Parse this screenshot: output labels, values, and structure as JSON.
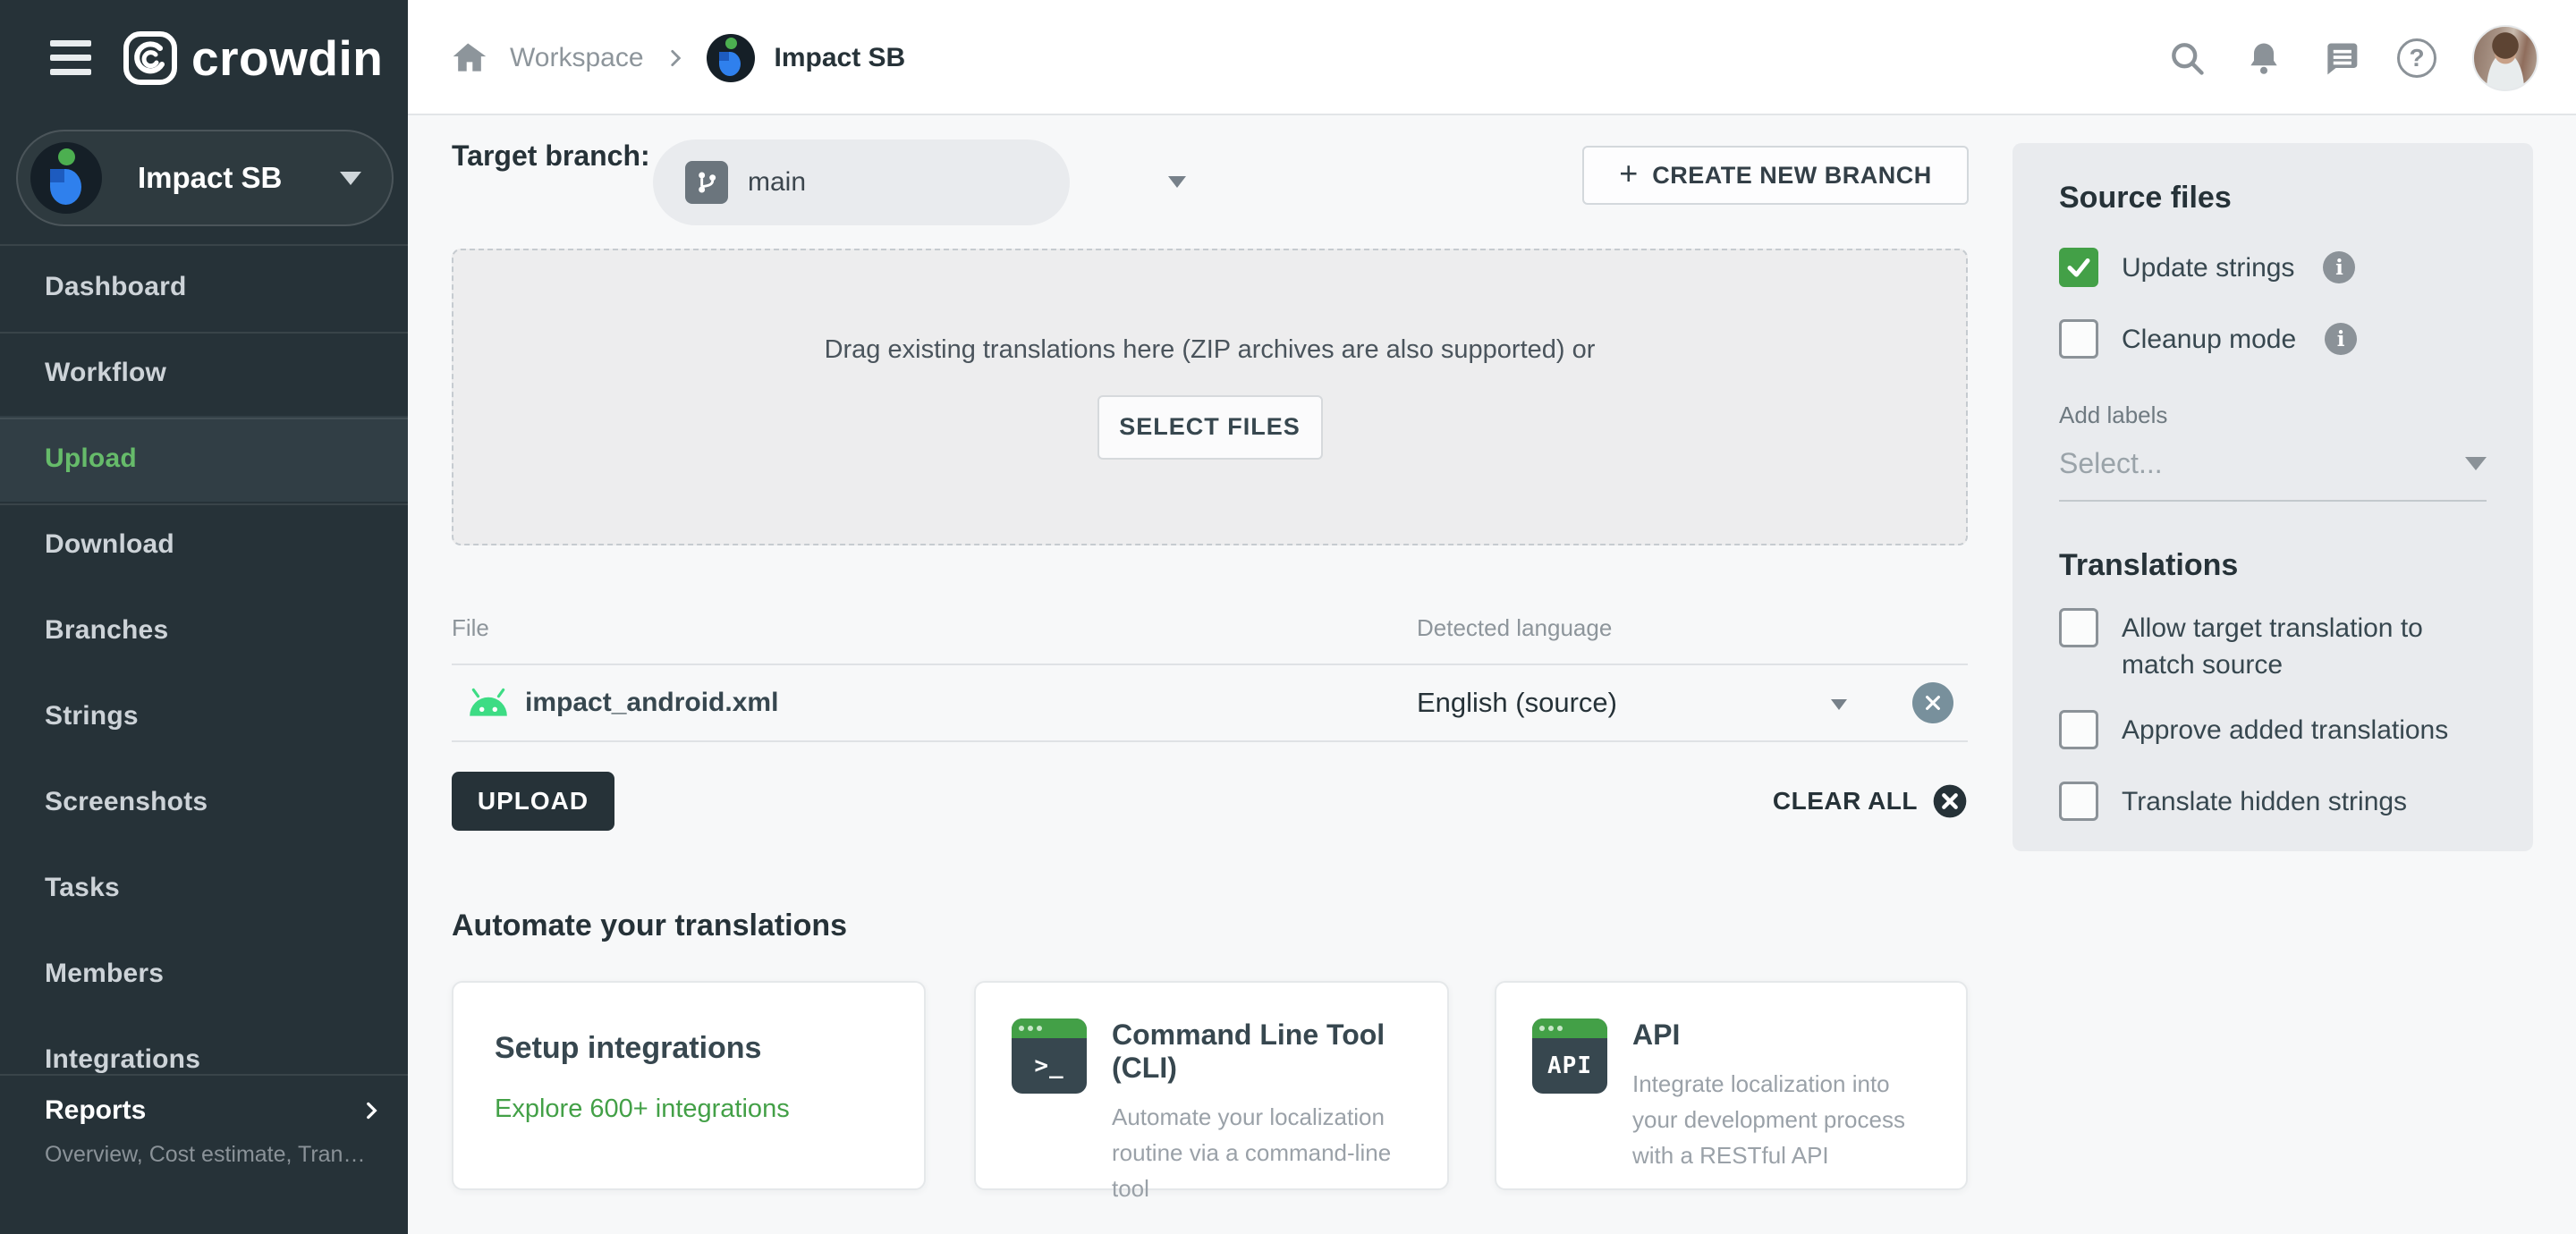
{
  "header": {
    "brand": "crowdin",
    "breadcrumb": {
      "workspace": "Workspace",
      "project": "Impact SB"
    }
  },
  "sidebar": {
    "project": "Impact SB",
    "items": [
      "Dashboard",
      "Workflow",
      "Upload",
      "Download",
      "Branches",
      "Strings",
      "Screenshots",
      "Tasks",
      "Members",
      "Integrations"
    ],
    "reports": {
      "label": "Reports",
      "subtitle": "Overview, Cost estimate, Transl…"
    }
  },
  "main": {
    "target_branch_label": "Target branch:",
    "branch": "main",
    "create_branch_label": "CREATE NEW BRANCH",
    "dropzone": {
      "text": "Drag existing translations here (ZIP archives are also supported) or",
      "button": "SELECT FILES"
    },
    "table": {
      "col_file": "File",
      "col_lang": "Detected language",
      "rows": [
        {
          "file": "impact_android.xml",
          "language": "English (source)"
        }
      ]
    },
    "upload_label": "UPLOAD",
    "clear_all_label": "CLEAR ALL",
    "automate_heading": "Automate your translations",
    "cards": [
      {
        "title": "Setup integrations",
        "link": "Explore 600+ integrations"
      },
      {
        "title": "Command Line Tool (CLI)",
        "desc": "Automate your localization routine via a command-line tool",
        "icon_label": ">_"
      },
      {
        "title": "API",
        "desc": "Integrate localization into your development process with a RESTful API",
        "icon_label": "API"
      }
    ]
  },
  "panel": {
    "source_files": {
      "heading": "Source files",
      "options": [
        {
          "label": "Update strings",
          "checked": true
        },
        {
          "label": "Cleanup mode",
          "checked": false
        }
      ],
      "add_labels": "Add labels",
      "select_placeholder": "Select..."
    },
    "translations": {
      "heading": "Translations",
      "options": [
        "Allow target translation to match source",
        "Approve added translations",
        "Translate hidden strings"
      ]
    }
  },
  "icons": {
    "info": "i",
    "question": "?",
    "plus": "+"
  },
  "colors": {
    "accent_green": "#43a047",
    "sidebar_dark": "#263238",
    "active_green": "#66bb6a",
    "android_green": "#3ddc84"
  }
}
